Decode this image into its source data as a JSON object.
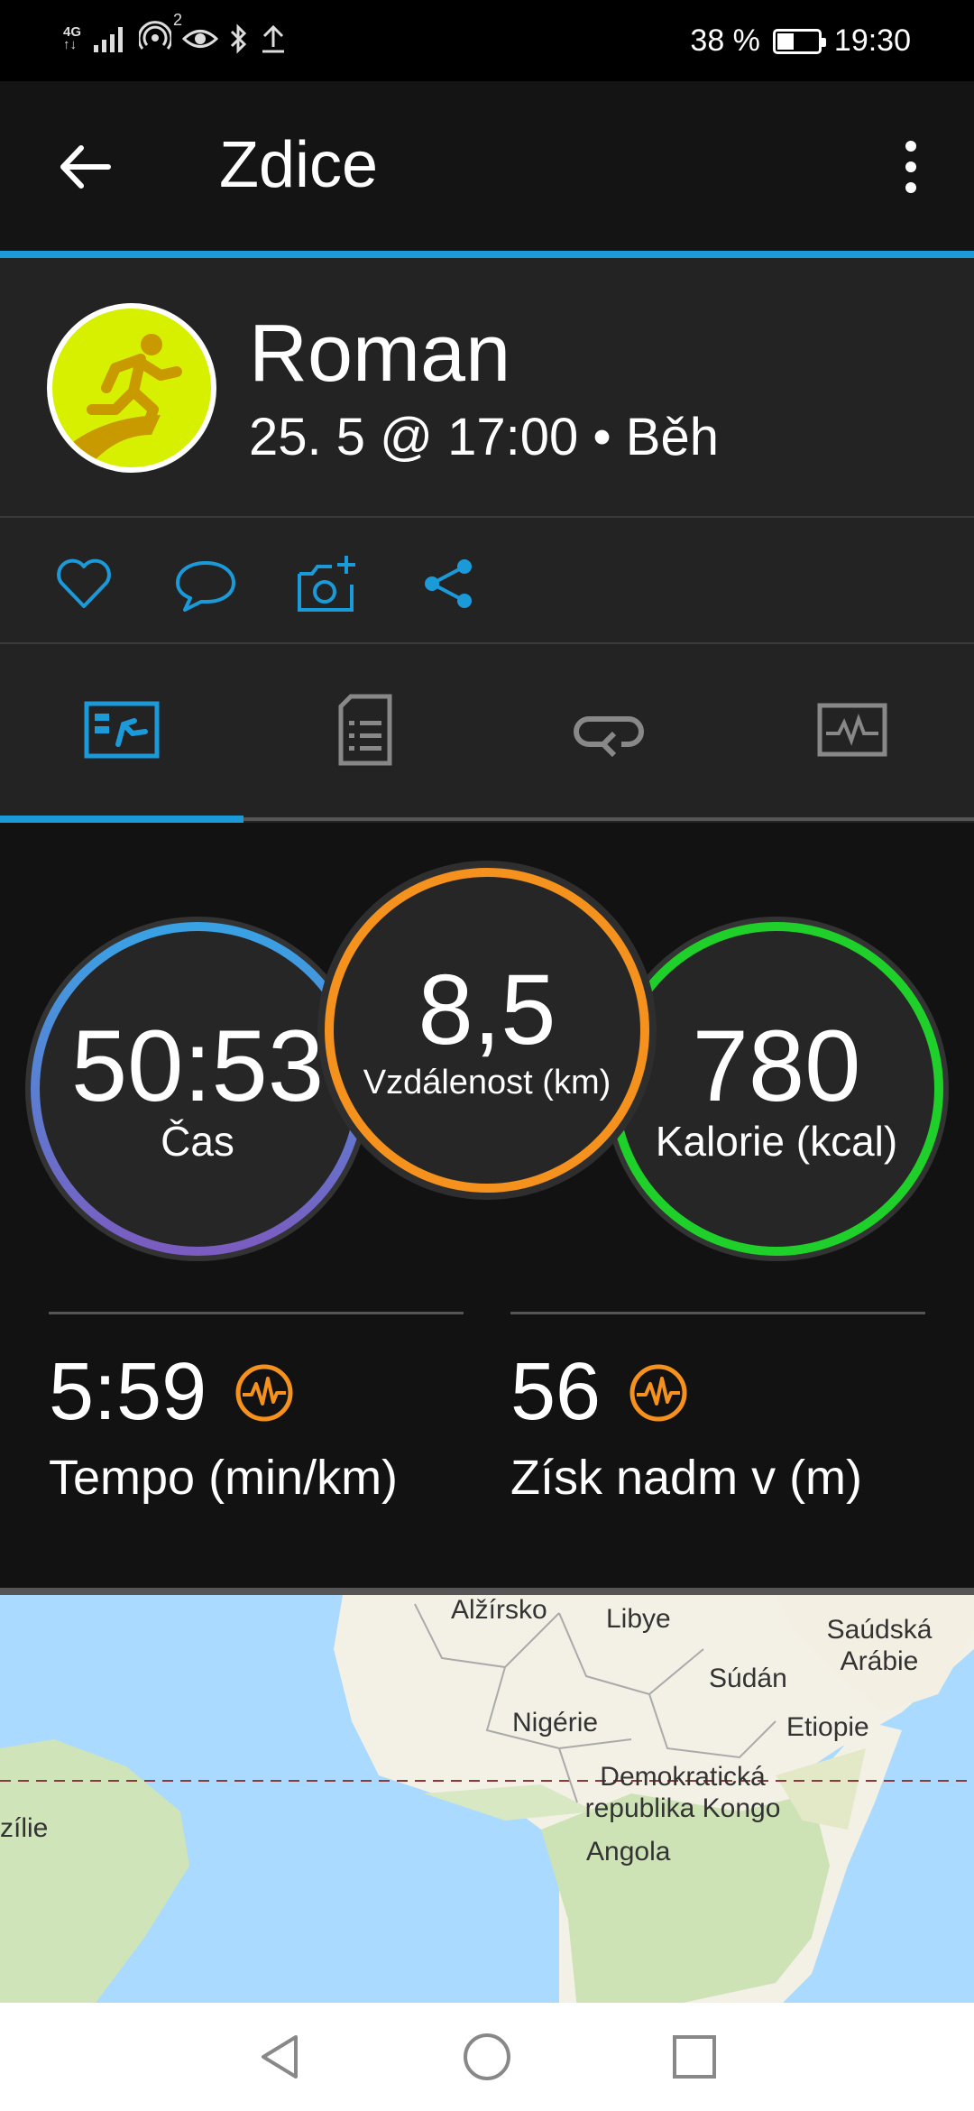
{
  "status_bar": {
    "network_top": "4G",
    "network_bottom": "↑↓",
    "hotspot_count": "2",
    "battery_text": "38 %",
    "time": "19:30"
  },
  "app_bar": {
    "title": "Zdice"
  },
  "profile": {
    "name": "Roman",
    "meta": "25. 5 @ 17:00 • Běh"
  },
  "tabs": {
    "selected_index": 0
  },
  "stats": {
    "time": {
      "value": "50:53",
      "label": "Čas"
    },
    "distance": {
      "value": "8,5",
      "label": "Vzdálenost (km)"
    },
    "calories": {
      "value": "780",
      "label": "Kalorie (kcal)"
    },
    "pace": {
      "value": "5:59",
      "label": "Tempo (min/km)"
    },
    "elevation": {
      "value": "56",
      "label": "Získ nadm v (m)"
    }
  },
  "map": {
    "labels": {
      "alzirsko": "Alžírsko",
      "libye": "Libye",
      "saudska": "Saúdská Arábie",
      "sudan": "Súdán",
      "nigerie": "Nigérie",
      "etiopie": "Etiopie",
      "kongo": "Demokratická republika Kongo",
      "brazilie": "zílie",
      "angola": "Angola"
    }
  },
  "colors": {
    "accent_blue": "#1b9ad9",
    "distance_orange": "#f5911d",
    "calories_green": "#20d02a",
    "time_gradient_start": "#38a3e5",
    "time_gradient_end": "#7c5bbf",
    "avatar_yellow": "#d7f000"
  }
}
